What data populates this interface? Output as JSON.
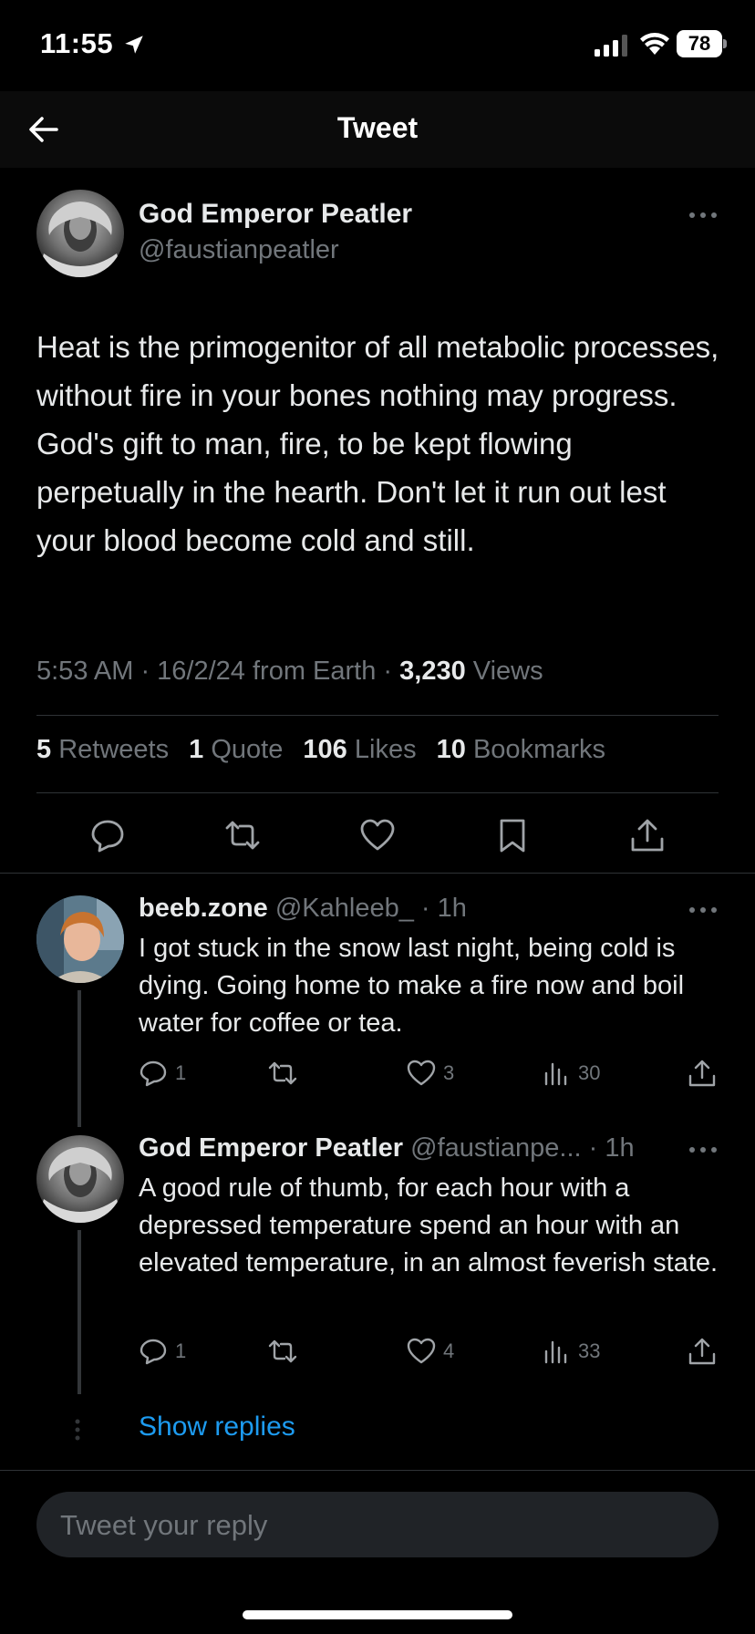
{
  "status_bar": {
    "time": "11:55",
    "battery": "78"
  },
  "nav": {
    "title": "Tweet"
  },
  "tweet": {
    "author_name": "God Emperor Peatler",
    "author_handle": "@faustianpeatler",
    "text": "Heat is the primogenitor of all metabolic processes, without fire in your bones nothing may progress. God's gift to man, fire, to be kept flowing perpetually in the hearth. Don't let it run out lest your blood become cold and still.",
    "timestamp": "5:53 AM · 16/2/24 from Earth · ",
    "views_count": "3,230",
    "views_label": " Views",
    "stats": {
      "retweets_count": "5",
      "retweets_label": " Retweets",
      "quotes_count": "1",
      "quotes_label": " Quote",
      "likes_count": "106",
      "likes_label": " Likes",
      "bookmarks_count": "10",
      "bookmarks_label": " Bookmarks"
    }
  },
  "replies": [
    {
      "name": "beeb.zone",
      "meta": " @Kahleeb_ · 1h",
      "text": "I got stuck in the snow last night, being cold is dying. Going home to make a fire now and boil water for coffee or tea.",
      "reply_count": "1",
      "like_count": "3",
      "view_count": "30"
    },
    {
      "name": "God Emperor Peatler",
      "meta": " @faustianpe... · 1h",
      "text": "A good rule of thumb, for each hour with a depressed temperature spend an hour with an elevated temperature, in an almost feverish state.",
      "reply_count": "1",
      "like_count": "4",
      "view_count": "33"
    }
  ],
  "show_replies_label": "Show replies",
  "composer": {
    "placeholder": "Tweet your reply"
  },
  "colors": {
    "accent": "#1d9bf0",
    "muted": "#71767b",
    "text": "#e7e9ea",
    "background": "#000000"
  }
}
